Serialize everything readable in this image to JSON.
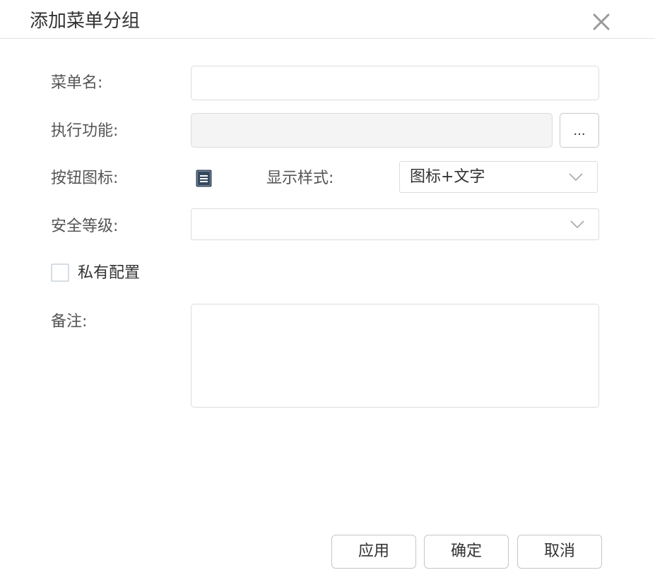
{
  "dialog": {
    "title": "添加菜单分组",
    "close_icon": "close-icon"
  },
  "form": {
    "menu_name": {
      "label": "菜单名:",
      "value": ""
    },
    "function": {
      "label": "执行功能:",
      "value": "",
      "browse_label": "..."
    },
    "button_icon": {
      "label": "按钮图标:",
      "icon": "document-list-icon"
    },
    "display_style": {
      "label": "显示样式:",
      "value": "图标+文字"
    },
    "security_level": {
      "label": "安全等级:",
      "value": ""
    },
    "private_config": {
      "label": "私有配置",
      "checked": false
    },
    "remark": {
      "label": "备注:",
      "value": ""
    }
  },
  "footer": {
    "apply_label": "应用",
    "ok_label": "确定",
    "cancel_label": "取消"
  },
  "colors": {
    "icon_fill": "#34495e",
    "border": "#dcdcdc",
    "disabled_bg": "#f4f4f4"
  }
}
